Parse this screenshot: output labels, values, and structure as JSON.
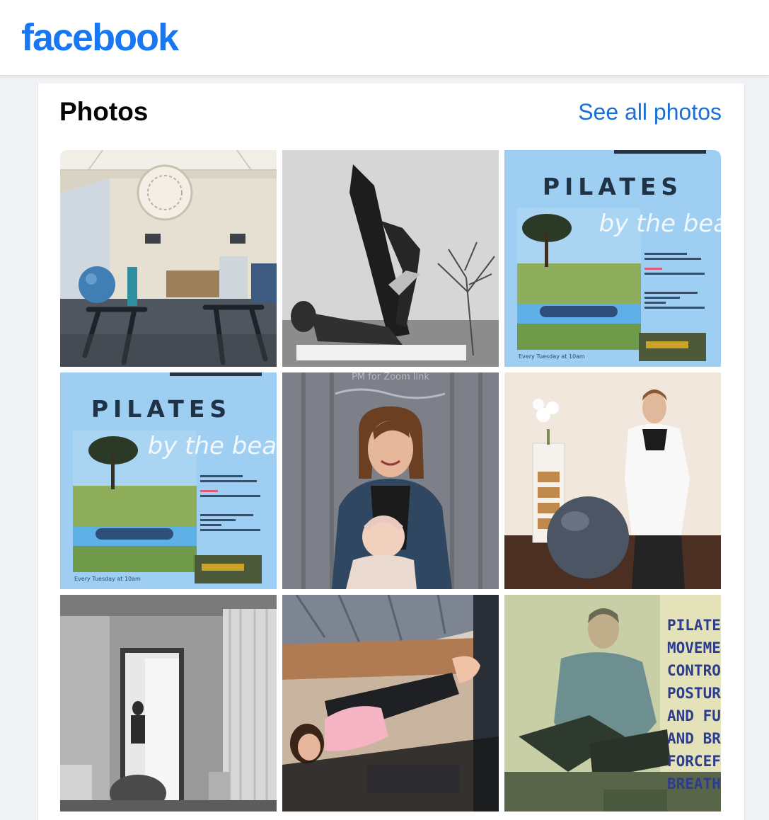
{
  "header": {
    "logo_text": "facebook",
    "brand_color": "#1877f2"
  },
  "photos_section": {
    "title": "Photos",
    "see_all_label": "See all photos",
    "link_color": "#1a6ed8"
  },
  "photos": [
    {
      "subject": "studio-interior-photo"
    },
    {
      "subject": "pilates-leg-lift-photo",
      "tone": "grayscale"
    },
    {
      "subject": "pilates-by-the-beach-flyer",
      "headline": "PILATES",
      "script": "by the beach",
      "footer": "Every Tuesday at 10am"
    },
    {
      "subject": "pilates-by-the-beach-flyer",
      "headline": "PILATES",
      "script": "by the beach",
      "footer": "Every Tuesday at 10am"
    },
    {
      "subject": "mother-and-baby-photo",
      "caption": "PM for Zoom link"
    },
    {
      "subject": "instructor-with-ball-photo"
    },
    {
      "subject": "studio-mirror-photo",
      "tone": "grayscale"
    },
    {
      "subject": "child-on-reformer-photo"
    },
    {
      "subject": "instructor-reformer-photo",
      "side_text": [
        "PILATES",
        "MOVEMENT",
        "CONTROL",
        "POSTURE",
        "AND FU",
        "AND BR",
        "FORCEF",
        "BREATH"
      ]
    }
  ]
}
